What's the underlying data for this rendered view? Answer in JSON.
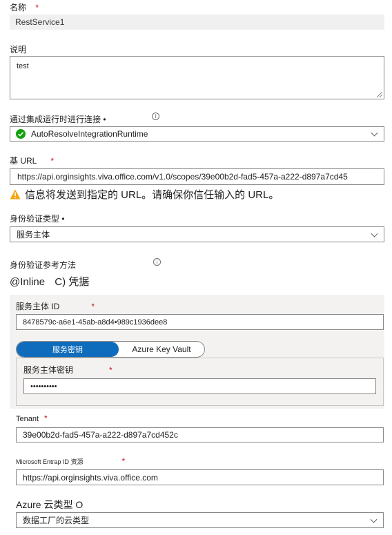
{
  "name_field": {
    "label": "名称",
    "value": "RestService1"
  },
  "description_field": {
    "label": "说明",
    "value": "test"
  },
  "connect_via": {
    "label": "通过集成运行时进行连接 •",
    "value": "AutoResolveIntegrationRuntime"
  },
  "base_url": {
    "label": "基 URL",
    "value": "https://api.orginsights.viva.office.com/v1.0/scopes/39e00b2d-fad5-457a-a222-d897a7cd45",
    "warning": "信息将发送到指定的 URL。请确保你信任输入的 URL。"
  },
  "auth_type": {
    "label": "身份验证类型 •",
    "value": "服务主体"
  },
  "auth_ref": {
    "label": "身份验证参考方法",
    "option_inline": "@Inline",
    "option_credential": "C) 凭据"
  },
  "service_principal_id": {
    "label": "服务主体 ID",
    "value": "8478579c-a6e1-45ab-a8d4•989c1936dee8"
  },
  "secret_toggle": {
    "option_key": "服务密钥",
    "option_vault": "Azure Key Vault"
  },
  "service_principal_key": {
    "label": "服务主体密钥",
    "value": "••••••••••"
  },
  "tenant": {
    "label": "Tenant",
    "value": "39e00b2d-fad5-457a-a222-d897a7cd452c"
  },
  "entra_resource": {
    "label": "Microsoft Entrap ID 资源",
    "value": "https://api.orginsights.viva.office.com"
  },
  "azure_cloud": {
    "label": "Azure 云类型 O",
    "value": "数据工厂的云类型"
  },
  "colors": {
    "accent": "#0f6cbd",
    "required": "#c50f1f",
    "success": "#13a10e",
    "warning": "#f7a30b"
  }
}
